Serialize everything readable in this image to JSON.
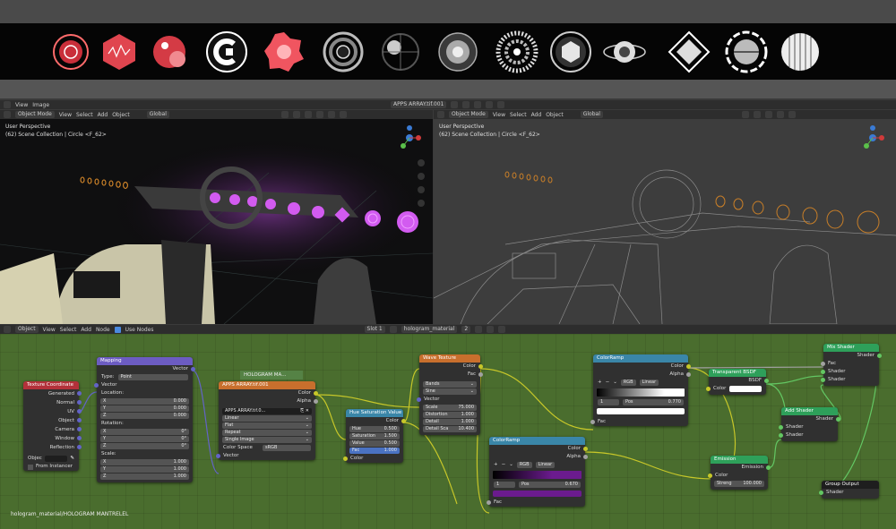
{
  "top_header": {
    "menu_view": "View",
    "menu_image": "Image",
    "image_name": "APPS ARRAY.tif.001"
  },
  "viewport_header": {
    "mode": "Object Mode",
    "menus": [
      "View",
      "Select",
      "Add",
      "Object"
    ],
    "orientation": "Global"
  },
  "viewport_left": {
    "title": "User Perspective",
    "subtitle": "(62) Scene Collection | Circle <F_62>"
  },
  "viewport_right": {
    "title": "User Perspective",
    "subtitle": "(62) Scene Collection | Circle <F_62>"
  },
  "node_header": {
    "type": "Object",
    "menus": [
      "View",
      "Select",
      "Add",
      "Node"
    ],
    "use_nodes": "Use Nodes",
    "slot": "Slot 1",
    "material": "hologram_material",
    "users": "2"
  },
  "nodes": {
    "texcoord": {
      "title": "Texture Coordinate",
      "outputs": [
        "Generated",
        "Normal",
        "UV",
        "Object",
        "Camera",
        "Window",
        "Reflection"
      ],
      "object_label": "Objec",
      "from_instancer": "From Instancer"
    },
    "mapping": {
      "title": "Mapping",
      "out": "Vector",
      "in": "Vector",
      "type_label": "Type:",
      "type_value": "Point",
      "location": "Location:",
      "rotation": "Rotation:",
      "scale": "Scale:",
      "loc": [
        {
          "k": "X",
          "v": "0.000"
        },
        {
          "k": "Y",
          "v": "0.000"
        },
        {
          "k": "Z",
          "v": "0.000"
        }
      ],
      "rot": [
        {
          "k": "X",
          "v": "0°"
        },
        {
          "k": "Y",
          "v": "0°"
        },
        {
          "k": "Z",
          "v": "0°"
        }
      ],
      "scl": [
        {
          "k": "X",
          "v": "1.000"
        },
        {
          "k": "Y",
          "v": "1.000"
        },
        {
          "k": "Z",
          "v": "1.000"
        }
      ]
    },
    "frame": {
      "label": "HOLOGRAM MA..."
    },
    "image": {
      "title": "APPS ARRAY.tif.001",
      "color": "Color",
      "alpha": "Alpha",
      "image": "APPS ARRAY.tif.0...",
      "interp": "Linear",
      "proj": "Flat",
      "ext": "Repeat",
      "source": "Single Image",
      "cs_label": "Color Space",
      "cs_value": "sRGB",
      "vector": "Vector"
    },
    "hsv": {
      "title": "Hue Saturation Value",
      "out": "Color",
      "hue": {
        "k": "Hue",
        "v": "0.500"
      },
      "sat": {
        "k": "Saturation",
        "v": "1.500"
      },
      "val": {
        "k": "Value",
        "v": "0.500"
      },
      "fac": {
        "k": "Fac",
        "v": "1.000"
      },
      "color": "Color"
    },
    "wave": {
      "title": "Wave Texture",
      "color": "Color",
      "fac": "Fac",
      "type": "Bands",
      "profile": "Sine",
      "vector": "Vector",
      "scale": {
        "k": "Scale",
        "v": "75.000"
      },
      "distortion": {
        "k": "Distortion",
        "v": "1.000"
      },
      "detail": {
        "k": "Detail",
        "v": "1.000"
      },
      "detail_scale": {
        "k": "Detail Sca",
        "v": "10.400"
      }
    },
    "ramp1": {
      "title": "ColorRamp",
      "color": "Color",
      "alpha": "Alpha",
      "mode": "RGB",
      "interp": "Linear",
      "index": "1",
      "pos_label": "Pos",
      "pos": "0.770",
      "fac": "Fac"
    },
    "ramp2": {
      "title": "ColorRamp",
      "color": "Color",
      "alpha": "Alpha",
      "mode": "RGB",
      "interp": "Linear",
      "index": "1",
      "pos_label": "Pos",
      "pos": "0.670",
      "fac": "Fac"
    },
    "transparent": {
      "title": "Transparent BSDF",
      "out": "BSDF",
      "color": "Color"
    },
    "emission": {
      "title": "Emission",
      "out": "Emission",
      "color": "Color",
      "strength": {
        "k": "Streng",
        "v": "100.000"
      }
    },
    "add": {
      "title": "Add Shader",
      "out": "Shader",
      "in1": "Shader",
      "in2": "Shader"
    },
    "mix": {
      "title": "Mix Shader",
      "out": "Shader",
      "fac": "Fac",
      "in1": "Shader",
      "in2": "Shader"
    },
    "output": {
      "title": "Group Output",
      "in": "Shader"
    }
  },
  "status": "hologram_material/HOLOGRAM MANTRELEL",
  "colors": {
    "node_bg": "#303030",
    "editor_bg": "#4a6d2e",
    "input_header": "#b3313a",
    "vector_header": "#6c5cc2",
    "texture_header": "#c86f2d",
    "converter_header": "#3a86a8",
    "shader_header": "#2ea05a",
    "group_header": "#1e1e1e",
    "color_socket": "#c7c729",
    "shader_socket": "#63c763",
    "vector_socket": "#6363c7"
  }
}
